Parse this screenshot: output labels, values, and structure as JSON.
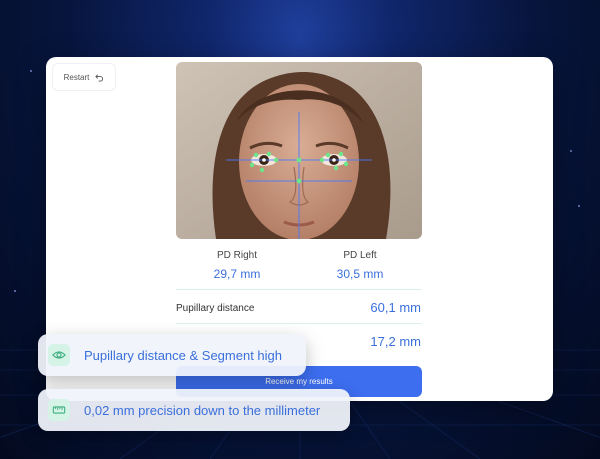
{
  "restart": {
    "label": "Restart",
    "icon": "undo-arrow-icon"
  },
  "measurements": {
    "pd_right": {
      "label": "PD Right",
      "value": "29,7 mm"
    },
    "pd_left": {
      "label": "PD Left",
      "value": "30,5 mm"
    },
    "pupillary_distance": {
      "label": "Pupillary distance",
      "value": "60,1 mm"
    },
    "segment_height": {
      "value": "17,2 mm"
    }
  },
  "cta": {
    "label": "Receive my results"
  },
  "features": [
    {
      "icon": "eye-icon",
      "text": "Pupillary distance & Segment high"
    },
    {
      "icon": "ruler-icon",
      "text": "0,02 mm precision down to the millimeter"
    }
  ],
  "colors": {
    "accent": "#3a6fdc",
    "button": "#3d6ef0",
    "icon_bg": "#d5f3e7",
    "background": "#07153d"
  }
}
